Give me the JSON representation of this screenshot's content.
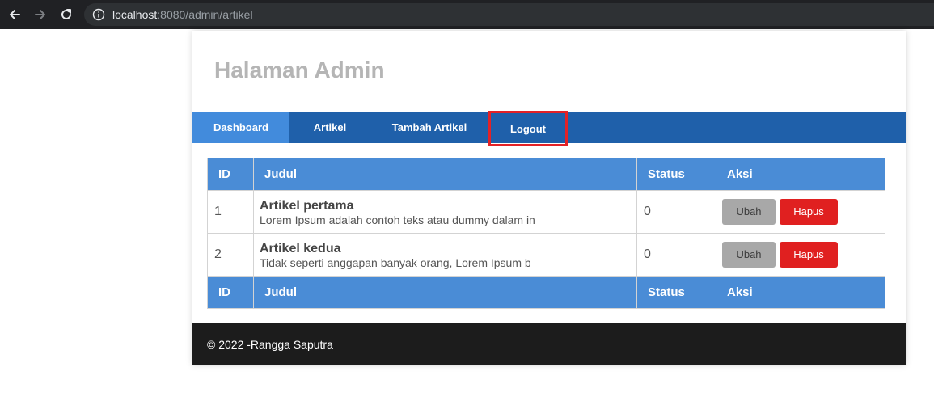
{
  "browser": {
    "url_host": "localhost",
    "url_rest": ":8080/admin/artikel",
    "colors": {
      "bar": "#202124",
      "url_box": "#2e3134"
    }
  },
  "header": {
    "title": "Halaman Admin"
  },
  "nav": {
    "items": [
      {
        "label": "Dashboard",
        "active": true
      },
      {
        "label": "Artikel",
        "active": false
      },
      {
        "label": "Tambah Artikel",
        "active": false
      },
      {
        "label": "Logout",
        "active": false,
        "highlighted": true
      }
    ],
    "colors": {
      "bg": "#1f60aa",
      "active": "#428bdc",
      "highlight_border": "#e32227"
    }
  },
  "table": {
    "headers": [
      "ID",
      "Judul",
      "Status",
      "Aksi"
    ],
    "rows": [
      {
        "id": "1",
        "title": "Artikel pertama",
        "desc": "Lorem Ipsum adalah contoh teks atau dummy dalam in",
        "status": "0",
        "edit": "Ubah",
        "delete": "Hapus"
      },
      {
        "id": "2",
        "title": "Artikel kedua",
        "desc": "Tidak seperti anggapan banyak orang, Lorem Ipsum b",
        "status": "0",
        "edit": "Ubah",
        "delete": "Hapus"
      }
    ],
    "footers": [
      "ID",
      "Judul",
      "Status",
      "Aksi"
    ],
    "colors": {
      "header_bg": "#4a8cd6",
      "edit_btn": "#a8a8a8",
      "delete_btn": "#e02020"
    }
  },
  "footer": {
    "text": "© 2022 -Rangga Saputra"
  }
}
